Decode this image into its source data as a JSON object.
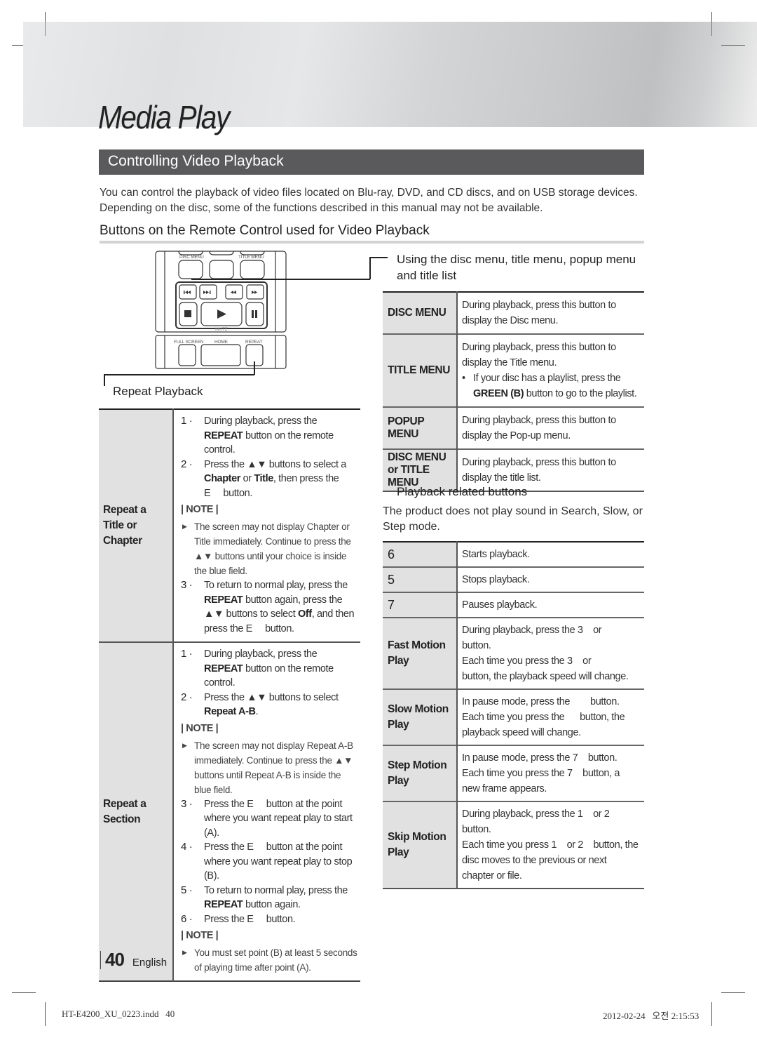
{
  "banner": {
    "title": "Media Play"
  },
  "section": {
    "title": "Controlling Video Playback"
  },
  "intro": "You can control the playback of video files located on Blu-ray, DVD, and CD discs, and on USB storage devices. Depending on the disc, some of the functions described in this manual may not be available.",
  "subheading": "Buttons on the Remote Control used for Video Playback",
  "remote": {
    "labels": {
      "disc_menu": "DISC MENU",
      "title_menu": "TITLE MENU",
      "mute": "MUTE",
      "full_screen": "FULL SCREEN",
      "home": "HOME",
      "repeat": "REPEAT"
    },
    "icons": [
      "skip-back-icon",
      "skip-forward-icon",
      "rewind-icon",
      "fast-forward-icon",
      "stop-icon",
      "play-icon",
      "pause-icon"
    ]
  },
  "repeat_playback": {
    "title": "Repeat Playback",
    "rows": [
      {
        "key": "Repeat a Title or Chapter",
        "steps_a": [
          {
            "num": "1 ·",
            "html": "During playback, press the <b>REPEAT</b> button on the remote control."
          },
          {
            "num": "2 ·",
            "html": "Press the ▲▼ buttons to select a <b>Chapter</b> or <b>Title</b>, then press the E&nbsp;&nbsp;&nbsp;&nbsp; button."
          }
        ],
        "note_label": "| NOTE |",
        "notes": [
          "The screen may not display Chapter or Title immediately. Continue to press the ▲▼ buttons until your choice is inside the blue field."
        ],
        "steps_b": [
          {
            "num": "3 ·",
            "html": "To return to normal play, press the <b>REPEAT</b> button again, press the ▲▼ buttons to select <b>Off</b>, and then press the E&nbsp;&nbsp;&nbsp;&nbsp; button."
          }
        ]
      },
      {
        "key": "Repeat a Section",
        "steps_a": [
          {
            "num": "1 ·",
            "html": "During playback, press the <b>REPEAT</b> button on the remote control."
          },
          {
            "num": "2 ·",
            "html": "Press the ▲▼ buttons to select <b>Repeat A-B</b>."
          }
        ],
        "note_label": "| NOTE |",
        "notes": [
          "The screen may not display Repeat A-B immediately. Continue to press the ▲▼ buttons until  Repeat A-B  is inside the blue field."
        ],
        "steps_b": [
          {
            "num": "3 ·",
            "html": "Press the E&nbsp;&nbsp;&nbsp;&nbsp; button at the point where you want repeat play to start (A)."
          },
          {
            "num": "4 ·",
            "html": "Press the E&nbsp;&nbsp;&nbsp;&nbsp; button at the point where you want repeat play to stop (B)."
          },
          {
            "num": "5 ·",
            "html": "To return to normal play, press the <b>REPEAT</b> button again."
          },
          {
            "num": "6 ·",
            "html": "Press the E&nbsp;&nbsp;&nbsp;&nbsp; button."
          }
        ],
        "note_label_2": "| NOTE |",
        "notes_2": [
          "You must set point (B) at least 5 seconds of playing time after point (A)."
        ]
      }
    ]
  },
  "menus": {
    "title": "Using the disc menu, title menu, popup menu and title list",
    "rows": [
      {
        "key": "DISC MENU",
        "desc": "During playback, press this button to display the Disc menu."
      },
      {
        "key": "TITLE MENU",
        "desc": "During playback, press this button to display the Title menu.",
        "bullet": "If your disc has a playlist, press the <b>GREEN (B)</b> button to go to the playlist."
      },
      {
        "key": "POPUP MENU",
        "desc": "During playback, press this button to display the Pop-up menu."
      },
      {
        "key": "DISC MENU or TITLE MENU",
        "desc": "During playback, press this button to display the title list."
      }
    ]
  },
  "playback": {
    "title": "Playback related buttons",
    "intro": "The product does not play sound in Search, Slow, or Step mode.",
    "rows": [
      {
        "key": "6",
        "glyph": true,
        "desc": "Starts playback."
      },
      {
        "key": "5",
        "glyph": true,
        "desc": "Stops playback."
      },
      {
        "key": "7",
        "glyph": true,
        "desc": "Pauses playback."
      },
      {
        "key": "Fast Motion Play",
        "desc": "During playback, press the 3&nbsp;&nbsp;&nbsp; or<br>button.<br>Each time you press the 3&nbsp;&nbsp;&nbsp; or<br>button, the playback speed will change."
      },
      {
        "key": "Slow Motion Play",
        "desc": "In pause mode, press the &nbsp;&nbsp;&nbsp;&nbsp;&nbsp;&nbsp;&nbsp;button.<br>Each time you press the &nbsp;&nbsp;&nbsp;&nbsp;&nbsp;button, the playback speed will change."
      },
      {
        "key": "Step Motion Play",
        "desc": "In pause mode, press the 7&nbsp;&nbsp;&nbsp; button.<br>Each time you press the 7&nbsp;&nbsp;&nbsp; button, a new frame appears."
      },
      {
        "key": "Skip Motion Play",
        "desc": "During playback, press the 1&nbsp;&nbsp;&nbsp; or 2<br>button.<br>Each time you press 1&nbsp;&nbsp;&nbsp; or 2&nbsp;&nbsp;&nbsp; button, the disc moves to the previous or next chapter or file."
      }
    ]
  },
  "footer": {
    "page_number": "40",
    "language": "English"
  },
  "slug": {
    "file": "HT-E4200_XU_0223.indd   40",
    "timestamp": "2012-02-24   오전 2:15:53"
  }
}
